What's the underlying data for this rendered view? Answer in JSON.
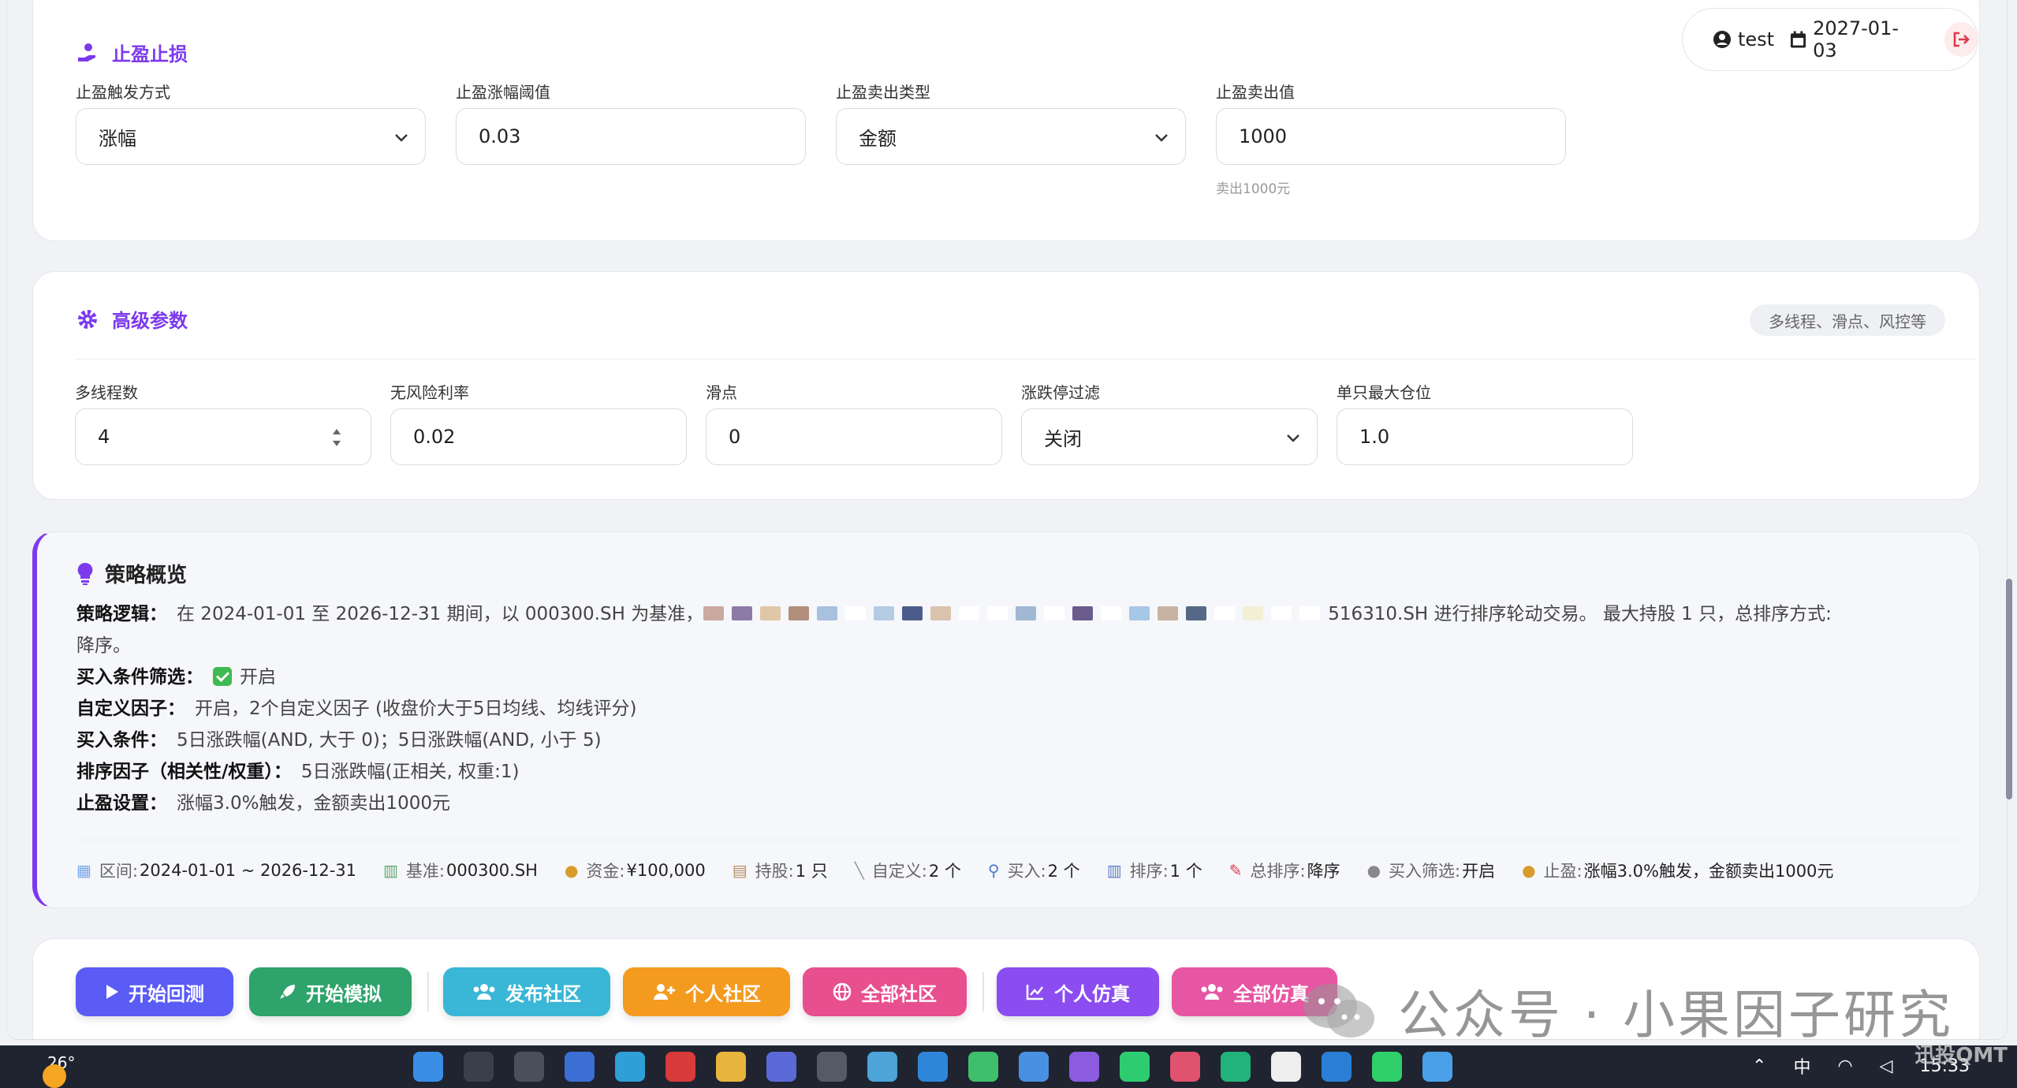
{
  "user": {
    "name": "test",
    "date": "2027-01-03"
  },
  "take_profit": {
    "title": "止盈止损",
    "fields": [
      {
        "label": "止盈触发方式",
        "value": "涨幅",
        "type": "select"
      },
      {
        "label": "止盈涨幅阈值",
        "value": "0.03",
        "type": "input"
      },
      {
        "label": "止盈卖出类型",
        "value": "金额",
        "type": "select"
      },
      {
        "label": "止盈卖出值",
        "value": "1000",
        "type": "input",
        "hint": "卖出1000元"
      }
    ]
  },
  "advanced": {
    "title": "高级参数",
    "badge": "多线程、滑点、风控等",
    "fields": [
      {
        "label": "多线程数",
        "value": "4",
        "type": "number"
      },
      {
        "label": "无风险利率",
        "value": "0.02",
        "type": "input"
      },
      {
        "label": "滑点",
        "value": "0",
        "type": "input"
      },
      {
        "label": "涨跌停过滤",
        "value": "关闭",
        "type": "select"
      },
      {
        "label": "单只最大仓位",
        "value": "1.0",
        "type": "input"
      }
    ]
  },
  "summary": {
    "title": "策略概览",
    "logic_key": "策略逻辑：",
    "logic_start": "在 2024-01-01 至 2026-12-31 期间，以 000300.SH 为基准，",
    "logic_end": "516310.SH 进行排序轮动交易。 最大持股 1 只，总排序方式:",
    "logic_line2": "降序。",
    "buy_filter_key": "买入条件筛选：",
    "buy_filter_val": "开启",
    "custom_key": "自定义因子：",
    "custom_val": "开启，2个自定义因子 (收盘价大于5日均线、均线评分)",
    "buy_cond_key": "买入条件：",
    "buy_cond_val": "5日涨跌幅(AND, 大于 0)；5日涨跌幅(AND, 小于 5)",
    "rank_key": "排序因子（相关性/权重）：",
    "rank_val": "5日涨跌幅(正相关, 权重:1)",
    "tp_key": "止盈设置：",
    "tp_val": "涨幅3.0%触发，金额卖出1000元",
    "stats": [
      {
        "icon": "calendar-icon",
        "glyph": "▦",
        "label": "区间:",
        "value": "2024-01-01 ~ 2026-12-31"
      },
      {
        "icon": "chart-icon",
        "glyph": "▥",
        "label": "基准:",
        "value": "000300.SH"
      },
      {
        "icon": "moneybag-icon",
        "glyph": "●",
        "label": "资金:",
        "value": "¥100,000"
      },
      {
        "icon": "clipboard-icon",
        "glyph": "▤",
        "label": "持股:",
        "value": "1 只"
      },
      {
        "icon": "wrench-icon",
        "glyph": "╲",
        "label": "自定义:",
        "value": "2 个"
      },
      {
        "icon": "magnifier-icon",
        "glyph": "⚲",
        "label": "买入:",
        "value": "2 个"
      },
      {
        "icon": "bar-chart-icon",
        "glyph": "▥",
        "label": "排序:",
        "value": "1 个"
      },
      {
        "icon": "pin-icon",
        "glyph": "✎",
        "label": "总排序:",
        "value": "降序"
      },
      {
        "icon": "circle-icon",
        "glyph": "●",
        "label": "买入筛选:",
        "value": "开启"
      },
      {
        "icon": "moneybag-icon",
        "glyph": "●",
        "label": "止盈:",
        "value": "涨幅3.0%触发，金额卖出1000元"
      }
    ]
  },
  "buttons": [
    {
      "label": "开始回测",
      "color": "#5b5bf6"
    },
    {
      "label": "开始模拟",
      "color": "#2ea36b"
    },
    {
      "label": "发布社区",
      "color": "#3ab6d6"
    },
    {
      "label": "个人社区",
      "color": "#f39a1f"
    },
    {
      "label": "全部社区",
      "color": "#e84f8f"
    },
    {
      "label": "个人仿真",
      "color": "#8b4cf0"
    },
    {
      "label": "全部仿真",
      "color": "#e656a3"
    }
  ],
  "watermark": {
    "text": "公众号 · 小果因子研究",
    "corner": "迅投QMT"
  },
  "taskbar": {
    "weather": "26°",
    "lang": "中",
    "time": "15:33"
  }
}
